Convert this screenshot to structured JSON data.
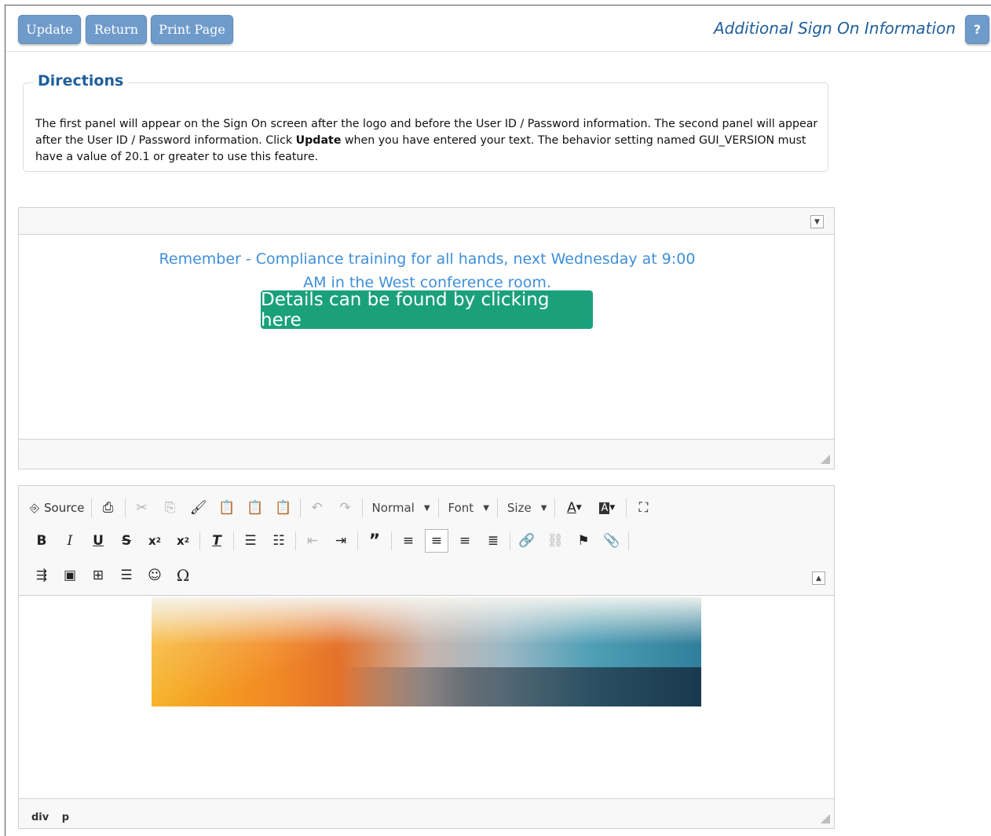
{
  "toolbar": {
    "update_label": "Update",
    "return_label": "Return",
    "print_label": "Print Page",
    "page_title": "Additional Sign On Information",
    "help_label": "?"
  },
  "directions": {
    "legend": "Directions",
    "text_part1": "The first panel will appear on the Sign On screen after the logo and before the User ID / Password information. The second panel will appear after the User ID / Password information. Click ",
    "text_bold": "Update",
    "text_part2": " when you have entered your text. The behavior setting named GUI_VERSION must have a value of 20.1 or greater to use this feature."
  },
  "editor1": {
    "notice": "Remember - Compliance training for all hands, next Wednesday at 9:00 AM in the West conference room.",
    "button_label": "Details can be found by clicking here"
  },
  "editor2": {
    "source_label": "Source",
    "format_combo": "Normal",
    "font_combo": "Font",
    "size_combo": "Size",
    "path": [
      "div",
      "p"
    ]
  },
  "colors": {
    "accent": "#6f9bcb",
    "title": "#1f5f9b",
    "notice_text": "#3f8fd8",
    "details_button": "#1aa17c"
  }
}
